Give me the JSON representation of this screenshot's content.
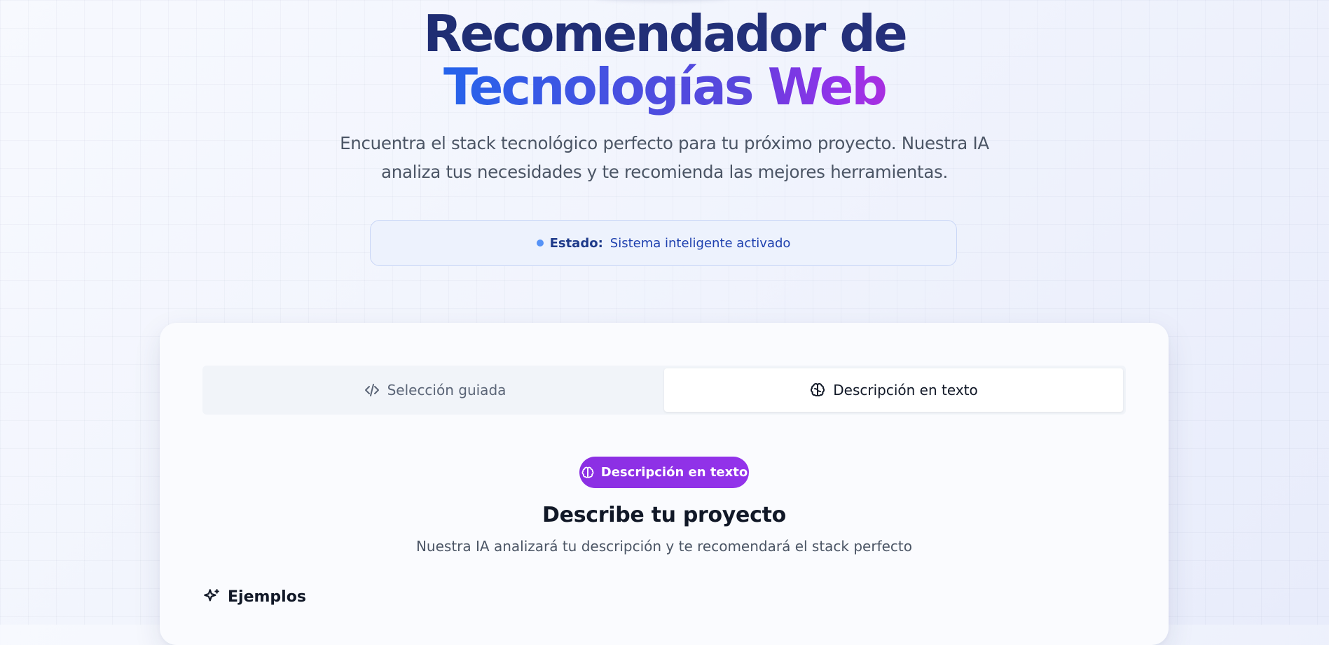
{
  "hero": {
    "title_line1": "Recomendador de",
    "title_tec": "Tecnologías",
    "title_web": "Web",
    "subtitle": "Encuentra el stack tecnológico perfecto para tu próximo proyecto. Nuestra IA analiza tus necesidades y te recomienda las mejores herramientas."
  },
  "status": {
    "label": "Estado:",
    "value": "Sistema inteligente activado",
    "dot_color": "#3b82f6"
  },
  "tabs": [
    {
      "label": "Selección guiada",
      "icon": "code-icon",
      "active": false
    },
    {
      "label": "Descripción en texto",
      "icon": "brain-icon",
      "active": true
    }
  ],
  "main": {
    "mode_badge": "Descripción en texto",
    "heading": "Describe tu proyecto",
    "description": "Nuestra IA analizará tu descripción y te recomendará el stack perfecto",
    "examples_title": "Ejemplos"
  },
  "colors": {
    "accent_blue": "#2563eb",
    "accent_purple": "#9333ea",
    "title_navy": "#1e2a6e"
  }
}
